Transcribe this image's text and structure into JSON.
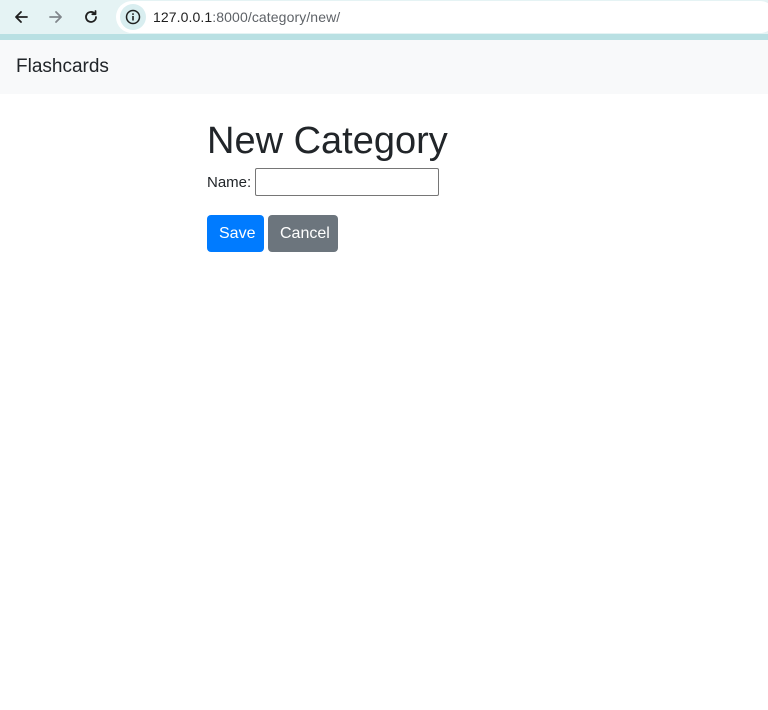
{
  "browser": {
    "url_host": "127.0.0.1",
    "url_path": ":8000/category/new/"
  },
  "navbar": {
    "brand": "Flashcards"
  },
  "page": {
    "title": "New Category",
    "form": {
      "name_label": "Name:",
      "name_value": ""
    },
    "actions": {
      "save_label": "Save",
      "cancel_label": "Cancel"
    }
  },
  "colors": {
    "toolbar_bg": "#e5f3f4",
    "navbar_bg": "#f8f9fa",
    "primary": "#007bff",
    "secondary": "#6c757d"
  }
}
